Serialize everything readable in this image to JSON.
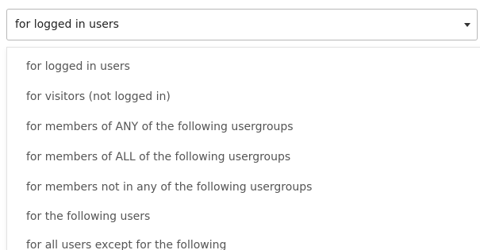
{
  "select": {
    "value": "for logged in users",
    "icon": "caret-down-icon"
  },
  "dropdown": {
    "options": [
      "for logged in users",
      "for visitors (not logged in)",
      "for members of ANY of the following usergroups",
      "for members of ALL of the following usergroups",
      "for members not in any of the following usergroups",
      "for the following users",
      "for all users except for the following"
    ]
  }
}
